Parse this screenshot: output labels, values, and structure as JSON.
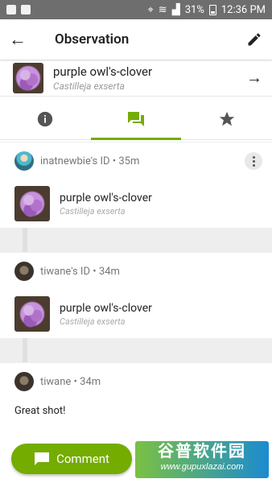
{
  "status_bar": {
    "battery": "31%",
    "time": "12:36 PM"
  },
  "app_bar": {
    "title": "Observation"
  },
  "observation": {
    "common_name": "purple owl's-clover",
    "scientific_name": "Castilleja exserta"
  },
  "identifications": [
    {
      "user_label": "inatnewbie's ID • 35m",
      "common_name": "purple owl's-clover",
      "scientific_name": "Castilleja exserta"
    },
    {
      "user_label": "tiwane's ID • 34m",
      "common_name": "purple owl's-clover",
      "scientific_name": "Castilleja exserta"
    }
  ],
  "comment": {
    "user_label": "tiwane • 34m",
    "text": "Great shot!"
  },
  "comment_button": {
    "label": "Comment"
  },
  "watermark": {
    "top": "谷普软件园",
    "bottom": "www.gupuxlazai.com"
  },
  "colors": {
    "accent": "#74ac00",
    "status_bar": "#6e6e6e"
  },
  "icons": [
    "back-arrow-icon",
    "edit-pencil-icon",
    "forward-arrow-icon",
    "info-icon",
    "comments-icon",
    "star-icon",
    "kebab-menu-icon",
    "chat-bubble-icon"
  ]
}
